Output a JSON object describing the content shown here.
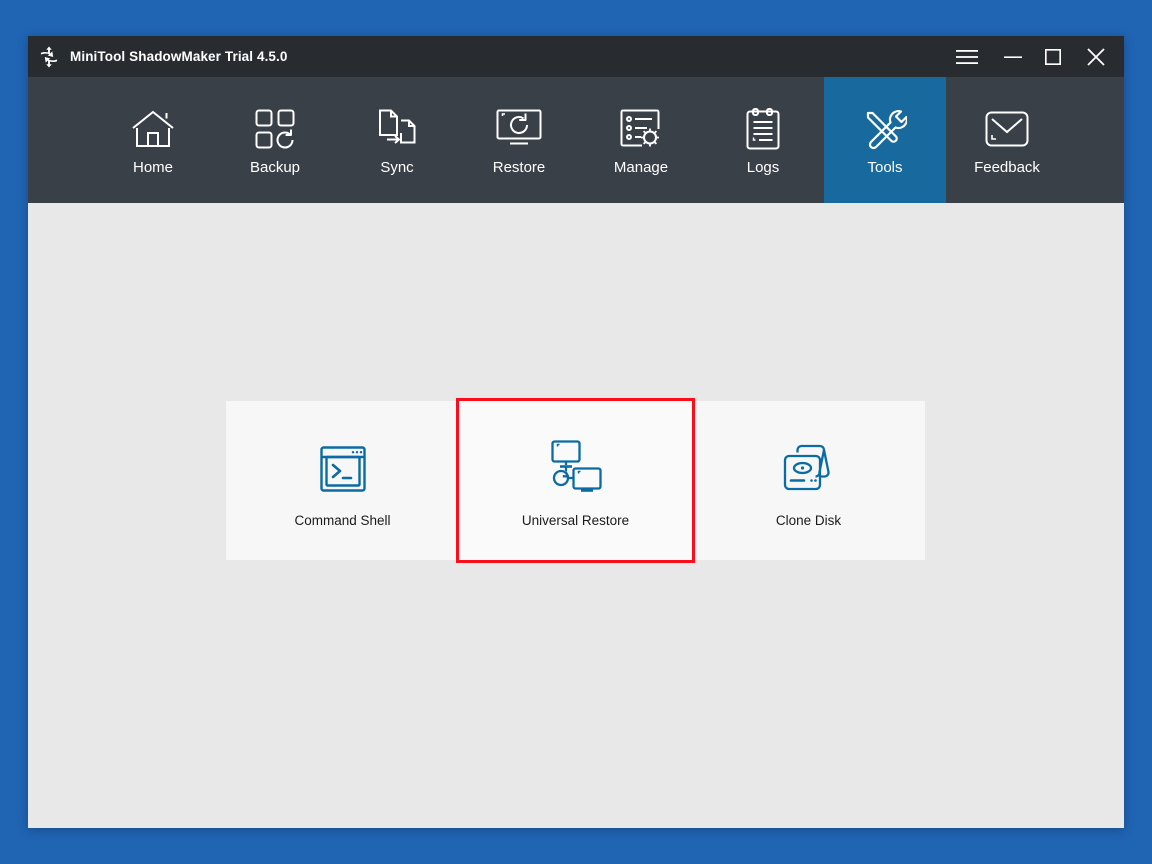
{
  "window": {
    "title": "MiniTool ShadowMaker Trial 4.5.0",
    "logo_icon": "four-way-arrows-logo",
    "controls": [
      {
        "name": "menu",
        "icon": "hamburger-menu-icon",
        "label": "Menu"
      },
      {
        "name": "minimize",
        "icon": "minimize-icon",
        "label": "Minimize"
      },
      {
        "name": "maximize",
        "icon": "maximize-icon",
        "label": "Maximize"
      },
      {
        "name": "close",
        "icon": "close-icon",
        "label": "Close"
      }
    ]
  },
  "nav": {
    "active": "Tools",
    "items": [
      {
        "label": "Home",
        "icon": "home-icon",
        "active": false
      },
      {
        "label": "Backup",
        "icon": "backup-icon",
        "active": false
      },
      {
        "label": "Sync",
        "icon": "sync-icon",
        "active": false
      },
      {
        "label": "Restore",
        "icon": "restore-icon",
        "active": false
      },
      {
        "label": "Manage",
        "icon": "manage-icon",
        "active": false
      },
      {
        "label": "Logs",
        "icon": "logs-icon",
        "active": false
      },
      {
        "label": "Tools",
        "icon": "tools-icon",
        "active": true
      },
      {
        "label": "Feedback",
        "icon": "feedback-icon",
        "active": false
      }
    ]
  },
  "tools": {
    "cards": [
      {
        "label": "Command Shell",
        "icon": "command-shell-icon",
        "selected": false
      },
      {
        "label": "Universal Restore",
        "icon": "universal-restore-icon",
        "selected": true
      },
      {
        "label": "Clone Disk",
        "icon": "clone-disk-icon",
        "selected": false
      }
    ]
  },
  "colors": {
    "desktop_background": "#2064b4",
    "title_bar": "#282c31",
    "nav_bar": "#3a4048",
    "nav_active": "#17699e",
    "content_background": "#e8e8e8",
    "card_background": "#f7f7f7",
    "icon_blue": "#0b6ba4",
    "selection_red": "#fc0d1b"
  }
}
